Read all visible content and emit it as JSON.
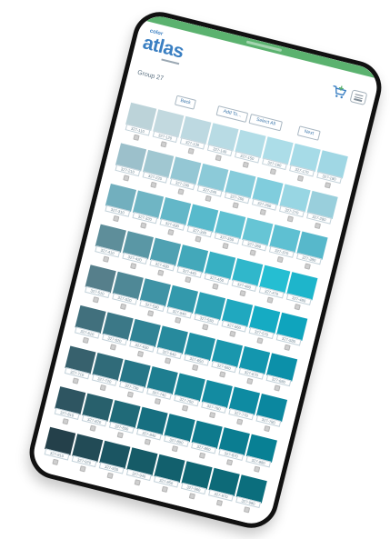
{
  "header": {
    "logo_small": "color",
    "logo_main": "atlas",
    "group_title": "Group 27"
  },
  "icons": {
    "cart": "cart-icon",
    "menu": "hamburger-menu-icon"
  },
  "toolbar": {
    "back": "Back",
    "add_to": "Add To...",
    "select_all": "Select All",
    "next": "Next"
  },
  "theme": {
    "accent": "#3a7fc2",
    "status_bar": "#5bb26f",
    "button_text": "#3f79ad"
  },
  "swatches": [
    [
      {
        "code": "327-110",
        "color": "#bcd3d9"
      },
      {
        "code": "327-120",
        "color": "#c2d9df"
      },
      {
        "code": "327-130",
        "color": "#bdd9e1"
      },
      {
        "code": "327-140",
        "color": "#b8dbe4"
      },
      {
        "code": "327-150",
        "color": "#b2dde7"
      },
      {
        "code": "327-160",
        "color": "#acdde8"
      },
      {
        "code": "327-170",
        "color": "#a6dbe7"
      },
      {
        "code": "327-180",
        "color": "#a0d7e4"
      }
    ],
    [
      {
        "code": "327-210",
        "color": "#9cc0cb"
      },
      {
        "code": "327-220",
        "color": "#a0c7d1"
      },
      {
        "code": "327-230",
        "color": "#94c7d4"
      },
      {
        "code": "327-240",
        "color": "#8ccad8"
      },
      {
        "code": "327-250",
        "color": "#86ccdb"
      },
      {
        "code": "327-260",
        "color": "#80cddd"
      },
      {
        "code": "327-270",
        "color": "#98d6e3"
      },
      {
        "code": "327-280",
        "color": "#99cfdc"
      }
    ],
    [
      {
        "code": "327-310",
        "color": "#72afbe"
      },
      {
        "code": "327-320",
        "color": "#6fb5c4"
      },
      {
        "code": "327-330",
        "color": "#63b7c8"
      },
      {
        "code": "327-340",
        "color": "#58bacc"
      },
      {
        "code": "327-350",
        "color": "#60c1d2"
      },
      {
        "code": "327-360",
        "color": "#66c5d5"
      },
      {
        "code": "327-370",
        "color": "#5ec0d2"
      },
      {
        "code": "327-380",
        "color": "#57b8cb"
      }
    ],
    [
      {
        "code": "327-410",
        "color": "#5e8e9a"
      },
      {
        "code": "327-420",
        "color": "#5a97a5"
      },
      {
        "code": "327-430",
        "color": "#4fa1b2"
      },
      {
        "code": "327-440",
        "color": "#43a8ba"
      },
      {
        "code": "327-450",
        "color": "#38b0c3"
      },
      {
        "code": "327-460",
        "color": "#30b7cb"
      },
      {
        "code": "327-470",
        "color": "#25bed2"
      },
      {
        "code": "327-480",
        "color": "#1eb5cb"
      }
    ],
    [
      {
        "code": "327-510",
        "color": "#567f8b"
      },
      {
        "code": "327-520",
        "color": "#4f8896"
      },
      {
        "code": "327-530",
        "color": "#3f93a5"
      },
      {
        "code": "327-540",
        "color": "#3399ac"
      },
      {
        "code": "327-550",
        "color": "#2ba0b4"
      },
      {
        "code": "327-560",
        "color": "#20a8bf"
      },
      {
        "code": "327-570",
        "color": "#15abc3"
      },
      {
        "code": "327-580",
        "color": "#0fa4bd"
      }
    ],
    [
      {
        "code": "327-610",
        "color": "#41707d"
      },
      {
        "code": "327-620",
        "color": "#3b7887"
      },
      {
        "code": "327-630",
        "color": "#308395"
      },
      {
        "code": "327-640",
        "color": "#278a9d"
      },
      {
        "code": "327-650",
        "color": "#1f90a4"
      },
      {
        "code": "327-660",
        "color": "#1a97ad"
      },
      {
        "code": "327-670",
        "color": "#1396ae"
      },
      {
        "code": "327-680",
        "color": "#0c90a9"
      }
    ],
    [
      {
        "code": "327-710",
        "color": "#37616d"
      },
      {
        "code": "327-720",
        "color": "#306b79"
      },
      {
        "code": "327-730",
        "color": "#277687"
      },
      {
        "code": "327-740",
        "color": "#1e7e90"
      },
      {
        "code": "327-750",
        "color": "#178698"
      },
      {
        "code": "327-760",
        "color": "#138ba1"
      },
      {
        "code": "327-770",
        "color": "#0e8ba2"
      },
      {
        "code": "327-780",
        "color": "#0b879f"
      }
    ],
    [
      {
        "code": "327-810",
        "color": "#2e5561"
      },
      {
        "code": "327-820",
        "color": "#28606c"
      },
      {
        "code": "327-830",
        "color": "#206a78"
      },
      {
        "code": "327-840",
        "color": "#176f80"
      },
      {
        "code": "327-850",
        "color": "#117586"
      },
      {
        "code": "327-860",
        "color": "#0e7a8d"
      },
      {
        "code": "327-870",
        "color": "#0b7d91"
      },
      {
        "code": "327-880",
        "color": "#088094"
      }
    ],
    [
      {
        "code": "327-910",
        "color": "#24404a"
      },
      {
        "code": "327-920",
        "color": "#224b56"
      },
      {
        "code": "327-930",
        "color": "#1b5562"
      },
      {
        "code": "327-940",
        "color": "#165b67"
      },
      {
        "code": "327-950",
        "color": "#12606d"
      },
      {
        "code": "327-960",
        "color": "#0f6673"
      },
      {
        "code": "327-970",
        "color": "#0d6a78"
      },
      {
        "code": "327-980",
        "color": "#0b6e7d"
      }
    ]
  ]
}
